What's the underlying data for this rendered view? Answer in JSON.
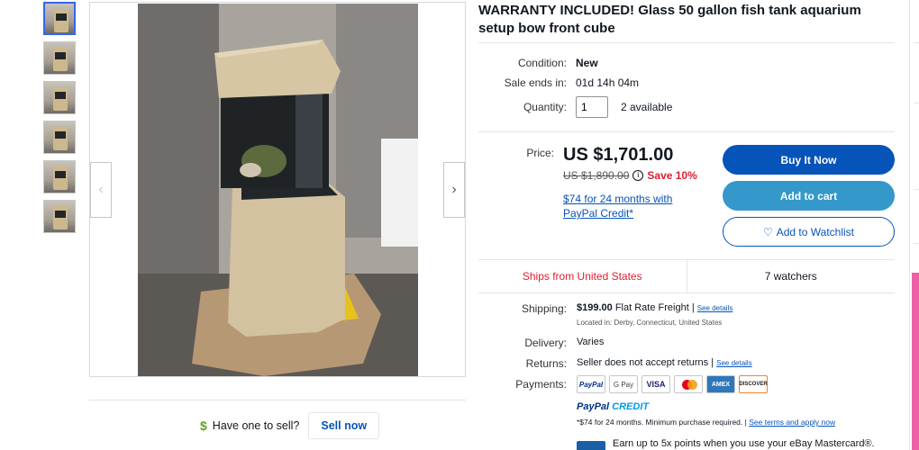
{
  "title": "WARRANTY INCLUDED! Glass 50 gallon fish tank aquarium setup bow front cube",
  "condition": {
    "label": "Condition:",
    "value": "New"
  },
  "sale_ends": {
    "label": "Sale ends in:",
    "value": "01d 14h 04m"
  },
  "quantity": {
    "label": "Quantity:",
    "value": "1",
    "available": "2 available"
  },
  "price": {
    "label": "Price:",
    "current": "US $1,701.00",
    "was": "US $1,890.00",
    "save": "Save 10%",
    "credit_offer": "$74 for 24 months with PayPal Credit*"
  },
  "buttons": {
    "buy_now": "Buy It Now",
    "add_to_cart": "Add to cart",
    "watchlist": "Add to Watchlist"
  },
  "ships_from": "Ships from United States",
  "watchers": "7 watchers",
  "shipping": {
    "label": "Shipping:",
    "cost": "$199.00",
    "method": "Flat Rate Freight",
    "see_details": "See details",
    "location": "Located in:  Derby, Connecticut, United States"
  },
  "delivery": {
    "label": "Delivery:",
    "value": "Varies"
  },
  "returns": {
    "label": "Returns:",
    "value": "Seller does not accept returns",
    "see_details": "See details"
  },
  "payments": {
    "label": "Payments:",
    "methods": [
      "PayPal",
      "G Pay",
      "VISA",
      "Mastercard",
      "AMEX",
      "DISCOVER"
    ]
  },
  "paypal_credit": {
    "brand_a": "PayPal",
    "brand_b": "CREDIT",
    "terms": "*$74 for 24 months. Minimum purchase required.",
    "terms_link": "See terms and apply now"
  },
  "mastercard_promo": "Earn up to 5x points when you use your eBay Mastercard®.",
  "sell": {
    "question": "Have one to sell?",
    "button": "Sell now"
  },
  "colors": {
    "primary_blue": "#0654ba",
    "cart_blue": "#3498ca",
    "sale_red": "#dd1e31",
    "accent_pink": "#ee5fa7"
  }
}
